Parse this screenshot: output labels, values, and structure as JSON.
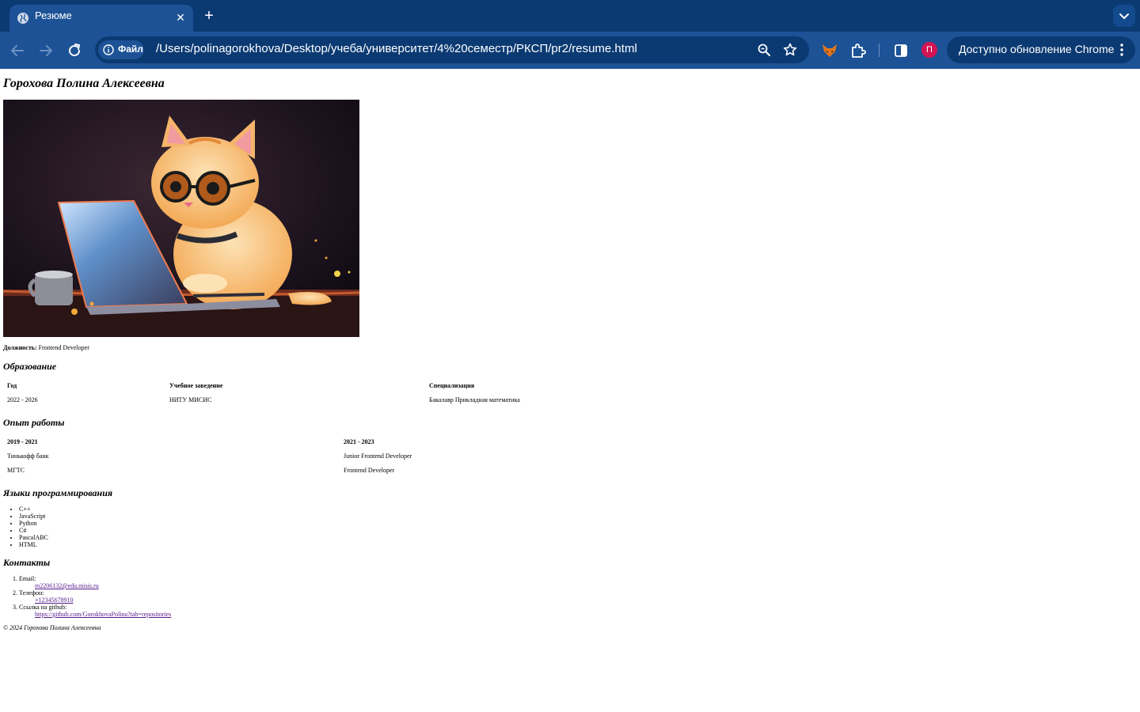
{
  "browser": {
    "tab": {
      "title": "Резюме"
    },
    "omnibox": {
      "chip_label": "Файл",
      "url": "/Users/polinagorokhova/Desktop/учеба/университет/4%20семестр/РКСП/pr2/resume.html"
    },
    "profile_initial": "П",
    "update_label": "Доступно обновление Chrome",
    "colors": {
      "tabstrip": "#0b3a73",
      "toolbar": "#1d5296",
      "avatar": "#d11453"
    },
    "icons": [
      "globe-icon",
      "close-icon",
      "plus-icon",
      "chevron-down-icon",
      "back-icon",
      "forward-icon",
      "reload-icon",
      "info-icon",
      "zoom-icon",
      "star-icon",
      "fox-extension-icon",
      "extensions-puzzle-icon",
      "side-panel-icon",
      "kebab-menu-icon"
    ]
  },
  "resume": {
    "name": "Горохова Полина Алексеевна",
    "photo_alt": "Кот за ноутбуком",
    "position_label": "Должность:",
    "position_value": "Frontend Developer",
    "education": {
      "heading": "Образование",
      "headers": [
        "Год",
        "Учебное заведение",
        "Специализация"
      ],
      "row": [
        "2022 - 2026",
        "НИТУ МИСИС",
        "Бакалавр Прикладная математика"
      ]
    },
    "experience": {
      "heading": "Опыт работы",
      "headers": [
        "2019 - 2021",
        "2021 - 2023"
      ],
      "rows": [
        [
          "Тинькофф банк",
          "Junior Frontend Developer"
        ],
        [
          "МГТС",
          "Frontend Developer"
        ]
      ]
    },
    "languages": {
      "heading": "Языки программирования",
      "items": [
        "C++",
        "JavaScript",
        "Python",
        "C#",
        "PascalABC",
        "HTML"
      ]
    },
    "contacts": {
      "heading": "Контакты",
      "items": [
        {
          "label": "Email:",
          "value": "m2206132@edu.misis.ru"
        },
        {
          "label": "Телефон:",
          "value": "+12345678910"
        },
        {
          "label": "Ссылка на github:",
          "value": "https://github.com/GorokhovaPolina?tab=repositories"
        }
      ]
    },
    "footer": "© 2024 Горохова Полина Алексеевна"
  }
}
